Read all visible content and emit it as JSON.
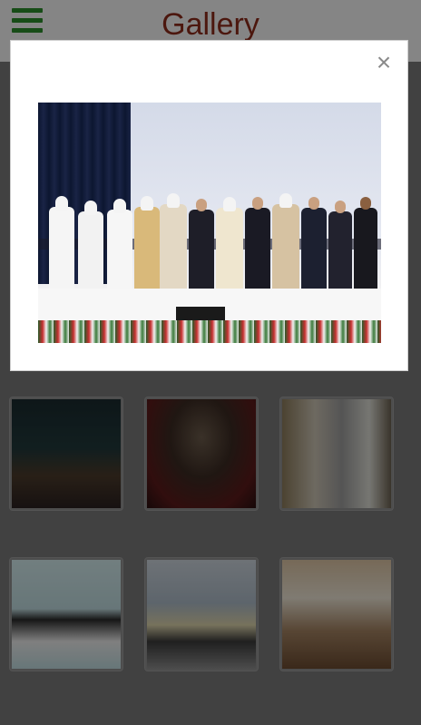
{
  "header": {
    "title": "Gallery",
    "menu_icon": "hamburger-icon"
  },
  "modal": {
    "close_label": "×",
    "photo_description": ""
  },
  "gallery": {
    "thumbnails": [
      "t1",
      "t2",
      "t3",
      "t4",
      "t5",
      "t6"
    ]
  },
  "colors": {
    "accent": "#2a8a2a",
    "title": "#8a2a1a",
    "modal_bg": "#ffffff"
  }
}
